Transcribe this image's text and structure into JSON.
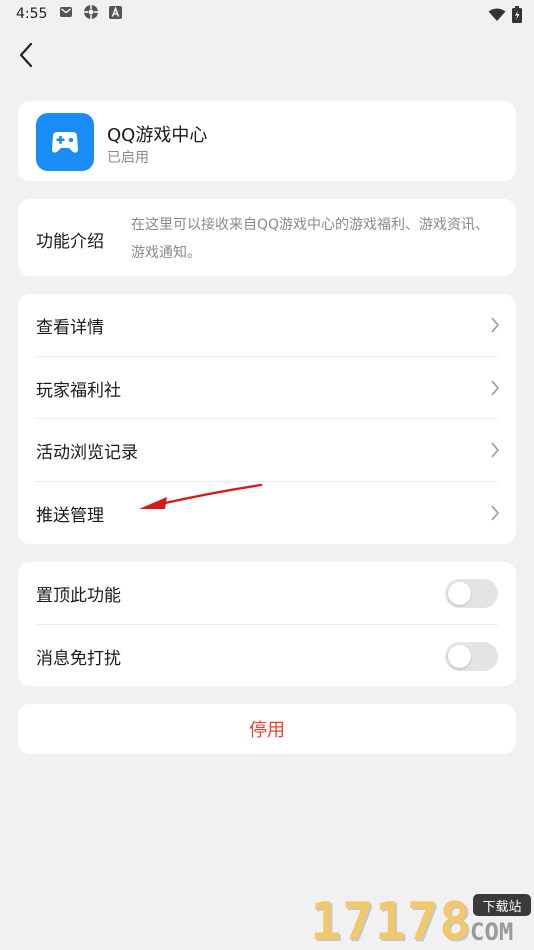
{
  "status_bar": {
    "time": "4:55"
  },
  "app": {
    "name": "QQ游戏中心",
    "status": "已启用"
  },
  "intro": {
    "label": "功能介绍",
    "description": "在这里可以接收来自QQ游戏中心的游戏福利、游戏资讯、游戏通知。"
  },
  "menu": {
    "items": [
      {
        "label": "查看详情"
      },
      {
        "label": "玩家福利社"
      },
      {
        "label": "活动浏览记录"
      },
      {
        "label": "推送管理"
      }
    ]
  },
  "toggles": {
    "pin": {
      "label": "置顶此功能",
      "on": false
    },
    "mute": {
      "label": "消息免打扰",
      "on": false
    }
  },
  "disable_button": {
    "label": "停用"
  },
  "watermark": {
    "number": "17178",
    "badge": "下载站",
    "domain": "COM"
  },
  "colors": {
    "accent": "#1a8cf5",
    "danger": "#e8422f",
    "annotation_arrow": "#d41a1a"
  }
}
